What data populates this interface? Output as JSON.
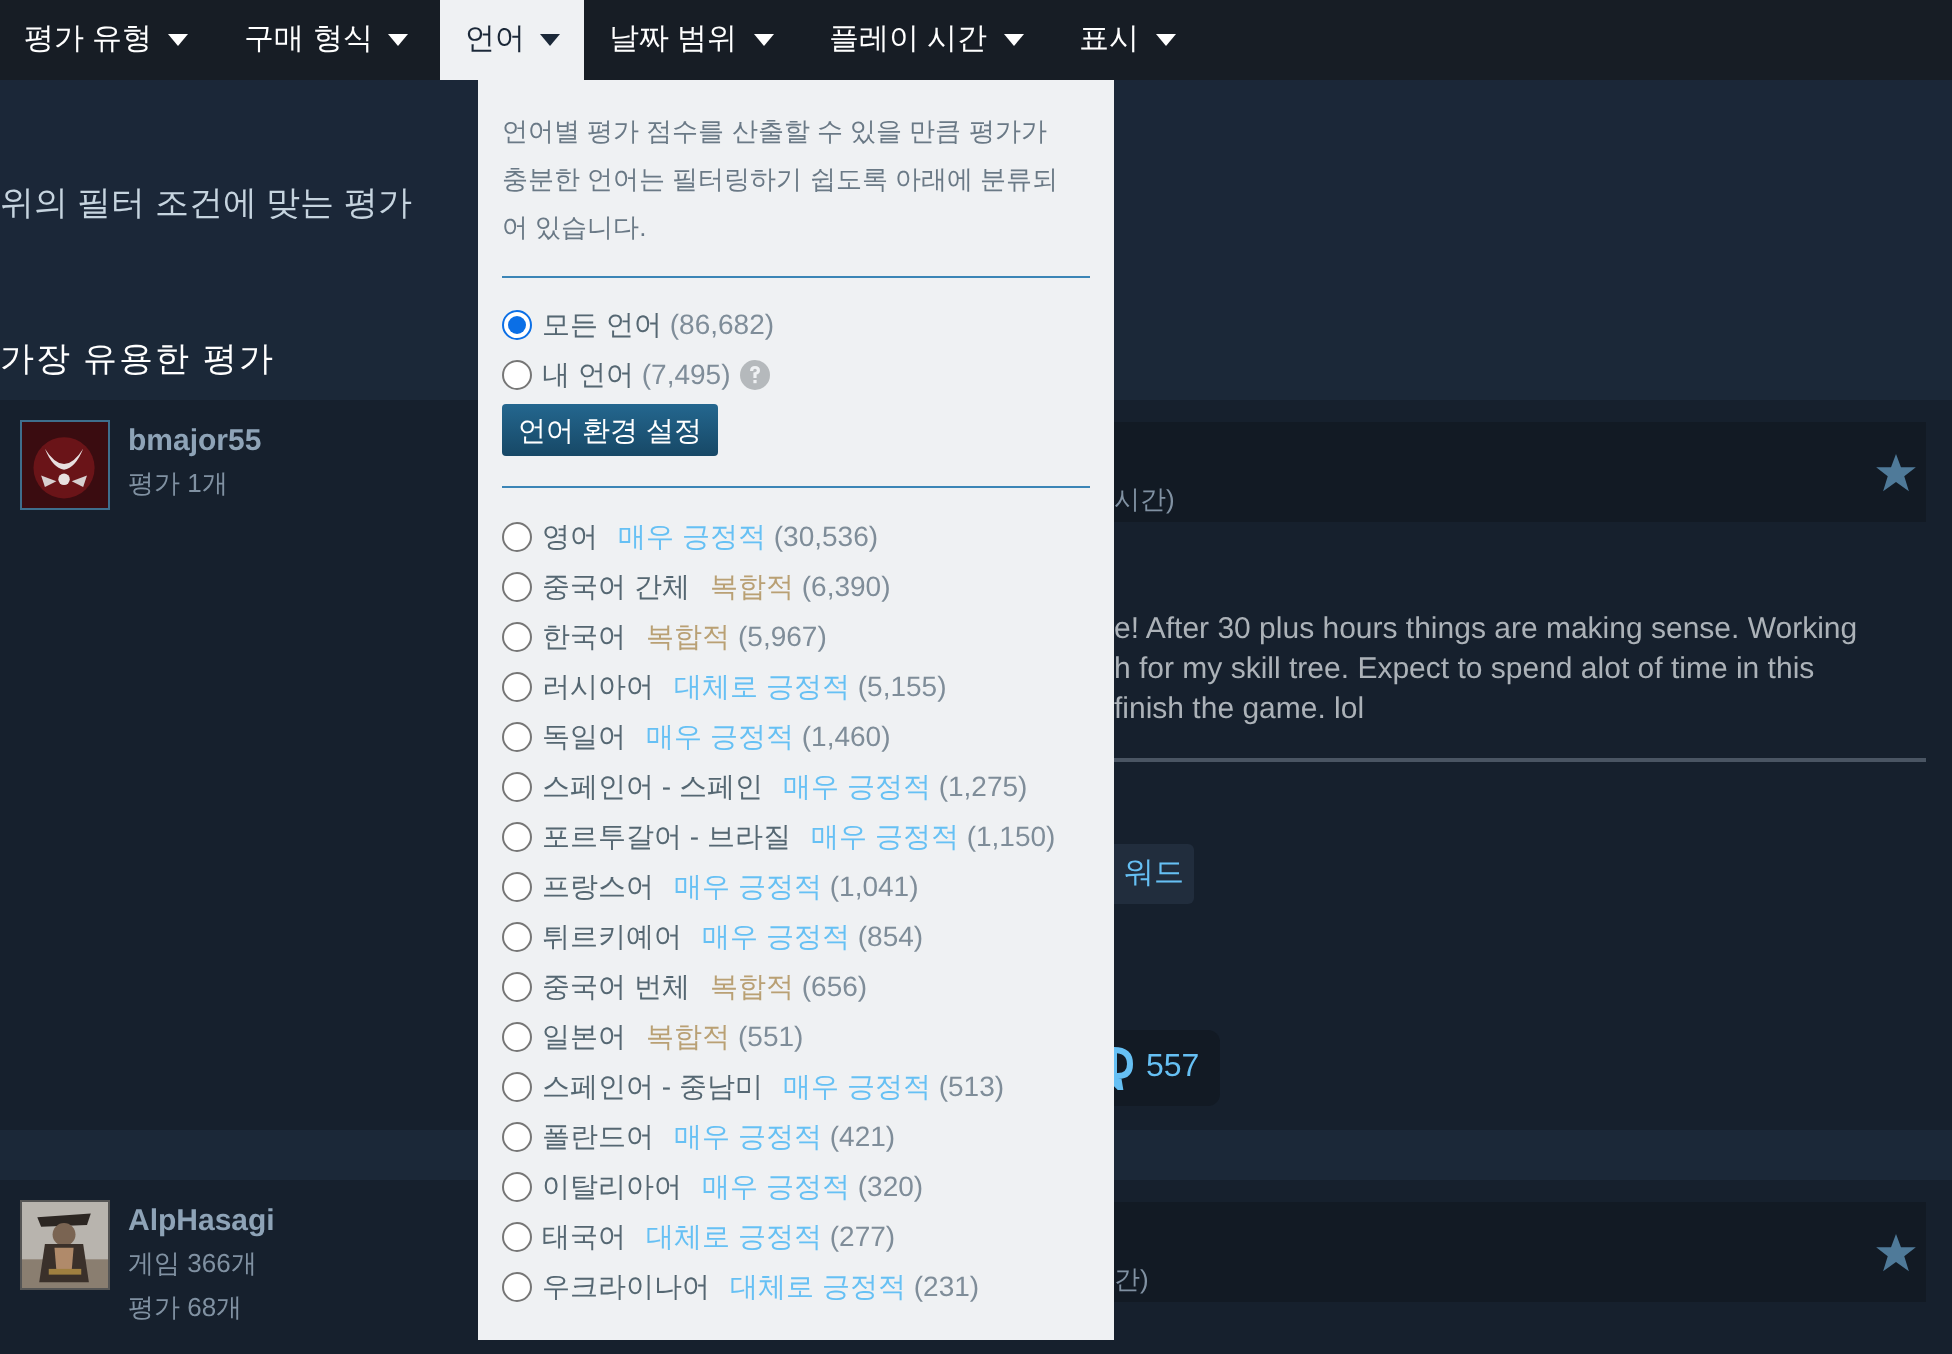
{
  "nav": [
    {
      "label": "평가 유형",
      "selected": false
    },
    {
      "label": "구매 형식",
      "selected": false
    },
    {
      "label": "언어",
      "selected": true
    },
    {
      "label": "날짜 범위",
      "selected": false
    },
    {
      "label": "플레이 시간",
      "selected": false
    },
    {
      "label": "표시",
      "selected": false
    }
  ],
  "summary": "위의 필터 조건에 맞는 평가",
  "section_title": "가장 유용한 평가",
  "reviews": [
    {
      "author": "bmajor55",
      "stats": [
        "평가 1개"
      ],
      "playtime_fragment": "시간)",
      "text_lines": [
        "e! After 30 plus hours things are making sense. Working",
        "h for my skill tree. Expect to spend alot of time in this",
        "finish the game. lol"
      ],
      "tag": "워드",
      "award_count": "557"
    },
    {
      "author": "AlpHasagi",
      "stats": [
        "게임 366개",
        "평가 68개"
      ],
      "playtime_fragment": "간)"
    }
  ],
  "language_dropdown": {
    "description": "언어별 평가 점수를 산출할 수 있을 만큼 평가가 충분한 언어는 필터링하기 쉽도록 아래에 분류되어 있습니다.",
    "options": [
      {
        "label": "모든 언어",
        "count": "(86,682)",
        "selected": true,
        "help": false
      },
      {
        "label": "내 언어",
        "count": "(7,495)",
        "selected": false,
        "help": true
      }
    ],
    "settings_button": "언어 환경 설정",
    "languages": [
      {
        "name": "영어",
        "rating": "매우 긍정적",
        "kind": "positive",
        "count": "(30,536)",
        "selected": false
      },
      {
        "name": "중국어 간체",
        "rating": "복합적",
        "kind": "mixed",
        "count": "(6,390)",
        "selected": false
      },
      {
        "name": "한국어",
        "rating": "복합적",
        "kind": "mixed",
        "count": "(5,967)",
        "selected": false
      },
      {
        "name": "러시아어",
        "rating": "대체로 긍정적",
        "kind": "positive",
        "count": "(5,155)",
        "selected": false
      },
      {
        "name": "독일어",
        "rating": "매우 긍정적",
        "kind": "positive",
        "count": "(1,460)",
        "selected": false
      },
      {
        "name": "스페인어 - 스페인",
        "rating": "매우 긍정적",
        "kind": "positive",
        "count": "(1,275)",
        "selected": false
      },
      {
        "name": "포르투갈어 - 브라질",
        "rating": "매우 긍정적",
        "kind": "positive",
        "count": "(1,150)",
        "selected": false
      },
      {
        "name": "프랑스어",
        "rating": "매우 긍정적",
        "kind": "positive",
        "count": "(1,041)",
        "selected": false
      },
      {
        "name": "튀르키예어",
        "rating": "매우 긍정적",
        "kind": "positive",
        "count": "(854)",
        "selected": false
      },
      {
        "name": "중국어 번체",
        "rating": "복합적",
        "kind": "mixed",
        "count": "(656)",
        "selected": false
      },
      {
        "name": "일본어",
        "rating": "복합적",
        "kind": "mixed",
        "count": "(551)",
        "selected": false
      },
      {
        "name": "스페인어 - 중남미",
        "rating": "매우 긍정적",
        "kind": "positive",
        "count": "(513)",
        "selected": false
      },
      {
        "name": "폴란드어",
        "rating": "매우 긍정적",
        "kind": "positive",
        "count": "(421)",
        "selected": false
      },
      {
        "name": "이탈리아어",
        "rating": "매우 긍정적",
        "kind": "positive",
        "count": "(320)",
        "selected": false
      },
      {
        "name": "태국어",
        "rating": "대체로 긍정적",
        "kind": "positive",
        "count": "(277)",
        "selected": false
      },
      {
        "name": "우크라이나어",
        "rating": "대체로 긍정적",
        "kind": "positive",
        "count": "(231)",
        "selected": false
      }
    ]
  }
}
